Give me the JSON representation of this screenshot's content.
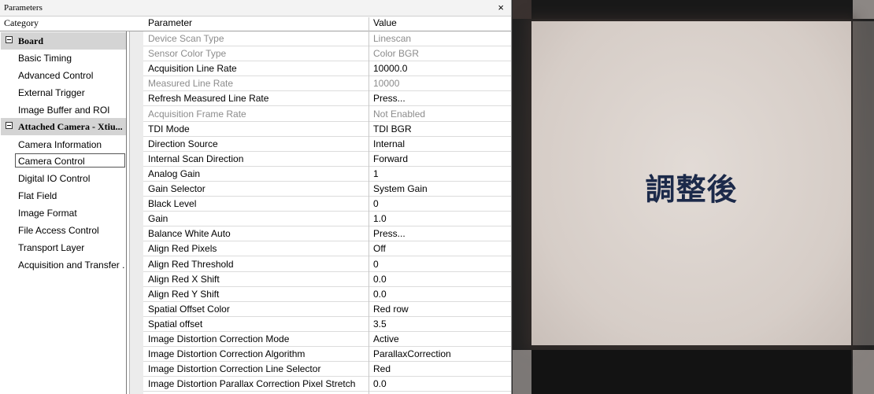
{
  "window": {
    "title": "Parameters",
    "close_glyph": "×"
  },
  "headers": {
    "category": "Category",
    "parameter": "Parameter",
    "value": "Value"
  },
  "categories": {
    "board": {
      "label": "Board",
      "items": [
        "Basic Timing",
        "Advanced Control",
        "External Trigger",
        "Image Buffer and ROI"
      ]
    },
    "camera": {
      "label": "Attached Camera - Xtiu...",
      "items": [
        "Camera Information",
        "Camera Control",
        "Digital IO Control",
        "Flat Field",
        "Image Format",
        "File Access Control",
        "Transport Layer",
        "Acquisition and Transfer ..."
      ]
    },
    "selected": "Camera Control"
  },
  "rows": [
    {
      "p": "Device Scan Type",
      "v": "Linescan",
      "disabled": true
    },
    {
      "p": "Sensor Color Type",
      "v": "Color BGR",
      "disabled": true
    },
    {
      "p": "Acquisition Line Rate",
      "v": "10000.0",
      "disabled": false
    },
    {
      "p": "Measured Line Rate",
      "v": "10000",
      "disabled": true
    },
    {
      "p": "Refresh Measured Line Rate",
      "v": "Press...",
      "disabled": false
    },
    {
      "p": "Acquisition Frame Rate",
      "v": "Not Enabled",
      "disabled": true
    },
    {
      "p": "TDI Mode",
      "v": "TDI BGR",
      "disabled": false
    },
    {
      "p": "Direction Source",
      "v": "Internal",
      "disabled": false
    },
    {
      "p": "Internal Scan Direction",
      "v": "Forward",
      "disabled": false
    },
    {
      "p": "Analog Gain",
      "v": "1",
      "disabled": false
    },
    {
      "p": "Gain Selector",
      "v": "System Gain",
      "disabled": false
    },
    {
      "p": "Black Level",
      "v": "0",
      "disabled": false
    },
    {
      "p": "Gain",
      "v": "1.0",
      "disabled": false
    },
    {
      "p": "Balance White Auto",
      "v": "Press...",
      "disabled": false
    },
    {
      "p": "Align Red Pixels",
      "v": "Off",
      "disabled": false
    },
    {
      "p": "Align Red Threshold",
      "v": "0",
      "disabled": false
    },
    {
      "p": "Align Red X Shift",
      "v": "0.0",
      "disabled": false
    },
    {
      "p": "Align Red Y Shift",
      "v": "0.0",
      "disabled": false
    },
    {
      "p": "Spatial Offset Color",
      "v": "Red row",
      "disabled": false
    },
    {
      "p": "Spatial offset",
      "v": "3.5",
      "disabled": false
    },
    {
      "p": "Image Distortion Correction Mode",
      "v": "Active",
      "disabled": false
    },
    {
      "p": "Image Distortion Correction Algorithm",
      "v": "ParallaxCorrection",
      "disabled": false
    },
    {
      "p": "Image Distortion Correction Line Selector",
      "v": "Red",
      "disabled": false
    },
    {
      "p": "Image Distortion Parallax Correction Pixel Stretch",
      "v": "0.0",
      "disabled": false
    }
  ],
  "image": {
    "caption": "調整後"
  }
}
